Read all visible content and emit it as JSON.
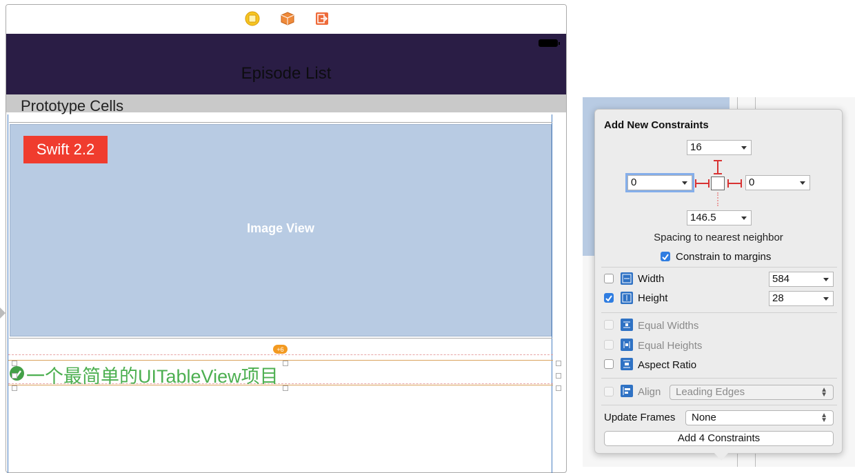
{
  "scene": {
    "dock_icons": [
      "view-controller-icon",
      "first-responder-icon",
      "exit-icon"
    ],
    "nav_title": "Episode List",
    "section_title": "Prototype Cells",
    "image_view_label": "Image View",
    "badge_text": "Swift 2.2",
    "constraint_badge": "+6",
    "selected_label_text": "一个最简单的UITableView项目"
  },
  "popover": {
    "title": "Add New Constraints",
    "top": "16",
    "left": "0",
    "right": "0",
    "bottom": "146.5",
    "spacing_label": "Spacing to nearest neighbor",
    "constrain_margins": {
      "label": "Constrain to margins",
      "checked": true
    },
    "width": {
      "label": "Width",
      "value": "584",
      "checked": false
    },
    "height": {
      "label": "Height",
      "value": "28",
      "checked": true
    },
    "equal_widths": {
      "label": "Equal Widths",
      "enabled": false
    },
    "equal_heights": {
      "label": "Equal Heights",
      "enabled": false
    },
    "aspect_ratio": {
      "label": "Aspect Ratio",
      "checked": false
    },
    "align": {
      "label": "Align",
      "value": "Leading Edges",
      "enabled": false
    },
    "update_frames": {
      "label": "Update Frames",
      "value": "None"
    },
    "add_button": "Add 4 Constraints"
  },
  "colors": {
    "nav_bar": "#2a1d45",
    "image_view": "#b8cbe3",
    "badge": "#f03c2e",
    "label_text": "#4caf50",
    "constraint": "#d83232",
    "checkbox_on": "#2f7de1"
  }
}
